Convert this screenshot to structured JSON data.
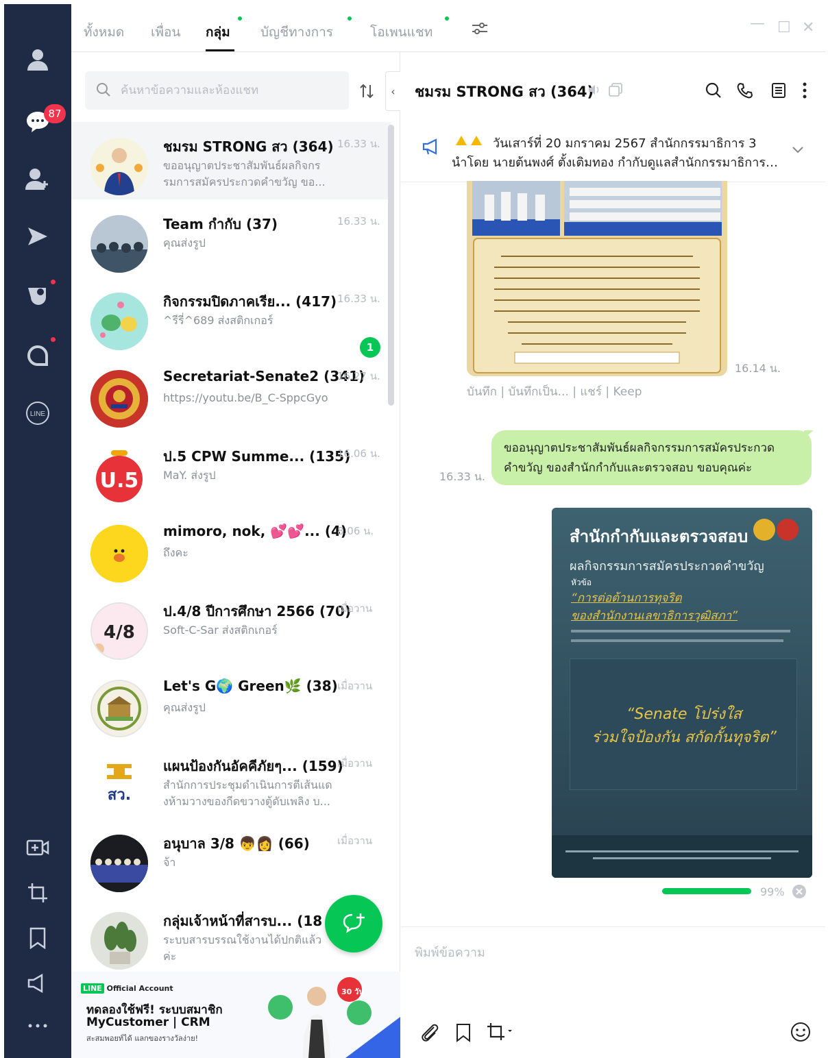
{
  "rail": {
    "unread_badge": "87"
  },
  "tabs": {
    "items": [
      {
        "label": "ทั้งหมด"
      },
      {
        "label": "เพื่อน"
      },
      {
        "label": "กลุ่ม"
      },
      {
        "label": "บัญชีทางการ"
      },
      {
        "label": "โอเพนแชท"
      }
    ],
    "active": "กลุ่ม"
  },
  "search": {
    "placeholder": "ค้นหาข้อความและห้องแชท"
  },
  "chats": [
    {
      "name": "ชมรม STRONG สว (364)",
      "preview": "ขออนุญาตประชาสัมพันธ์ผลกิจกร รมการสมัครประกวดคำขวัญ ขอ...",
      "time": "16.33 น."
    },
    {
      "name": "Team กำกับ (37)",
      "preview": "คุณส่งรูป",
      "time": "16.33 น."
    },
    {
      "name": "กิจกรรมปิดภาคเรีย... (417)",
      "preview": "^รีรี่^689 ส่งสติกเกอร์",
      "time": "16.33 น.",
      "unread": "1"
    },
    {
      "name": "Secretariat-Senate2 (341)",
      "preview": "https://youtu.be/B_C-SppcGyo",
      "time": "16.27 น."
    },
    {
      "name": "ป.5 CPW Summe... (135)",
      "preview": "MaY. ส่งรูป",
      "time": "16.06 น."
    },
    {
      "name": "mimoro, nok, 💕💕... (4)",
      "preview": "ถึงคะ",
      "time": "8.06 น."
    },
    {
      "name": "ป.4/8 ปีการศึกษา 2566 (70)",
      "preview": "Soft-C-Sar ส่งสติกเกอร์",
      "time": "เมื่อวาน"
    },
    {
      "name": "Let's G🌍 Green🌿 (38)",
      "preview": "คุณส่งรูป",
      "time": "เมื่อวาน"
    },
    {
      "name": "แผนป้องกันอัคคีภัยๆ... (159)",
      "preview": "สำนักการประชุมดำเนินการตีเส้นแด งห้ามวางของกีดขวางตู้ดับเพลิง บ...",
      "time": "เมื่อวาน"
    },
    {
      "name": "อนุบาล 3/8 👦👩 (66)",
      "preview": "จ้า",
      "time": "เมื่อวาน"
    },
    {
      "name": "กลุ่มเจ้าหน้าที่สารบ... (18",
      "preview": "ระบบสารบรรณใช้งานได้ปกติแล้วค่ะ",
      "time": ""
    }
  ],
  "ad": {
    "tag": "Official Account",
    "brand_short": "LINE",
    "line1": "ทดลองใช้ฟรี! ระบบสมาชิก",
    "line2": "MyCustomer | CRM",
    "line3": "สะสมพอยท์ได้ แลกของรางวัลง่าย!",
    "badge": "30 วัน"
  },
  "chat": {
    "title": "ชมรม STRONG สว (364)",
    "announcement_line1": "วันเสาร์ที่ 20 มกราคม 2567 สำนักกรรมาธิการ 3",
    "announcement_line2": "นำโดย นายต้นพงศ์ ตั้งเติมทอง กำกับดูแลสำนักกรรมาธิการ ...",
    "photo_time": "16.14 น.",
    "actions": "บันทึก | บันทึกเป็น... | แชร์ | Keep",
    "my_message": "ขออนุญาตประชาสัมพันธ์ผลกิจกรรมการสมัครประกวดคำขวัญ ของสำนักกำกับและตรวจสอบ ขอบคุณค่ะ",
    "my_time": "16.33 น.",
    "poster": {
      "title": "สำนักกำกับและตรวจสอบ",
      "subtitle": "ผลกิจกรรมการสมัครประกวดคำขวัญ",
      "topic_label": "หัวข้อ",
      "topic": "“การต่อต้านการทุจริต",
      "topic2": "ของสำนักงานเลขาธิการวุฒิสภา”",
      "quote1": "“Senate โปร่งใส",
      "quote2": "ร่วมใจป้องกัน สกัดกั้นทุจริต”"
    },
    "upload_progress": "99%",
    "composer_placeholder": "พิมพ์ข้อความ"
  },
  "colors": {
    "rail": "#1f2a44",
    "accent": "#06c755",
    "bubble": "#c8f0a8",
    "badge": "#f2334d"
  }
}
